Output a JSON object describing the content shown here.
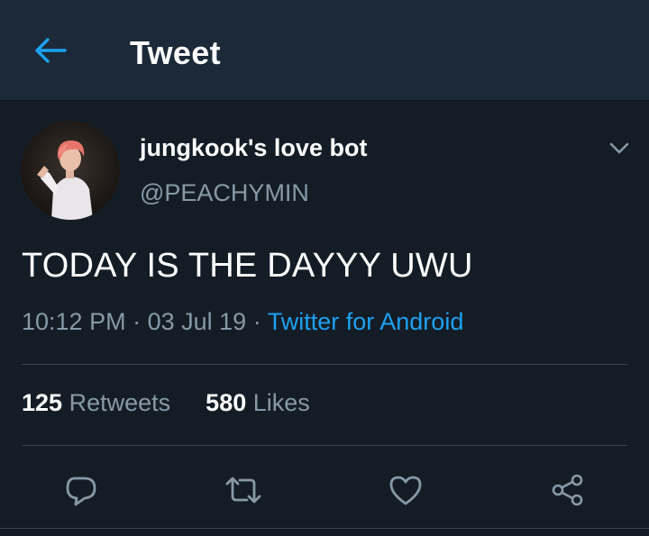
{
  "header": {
    "title": "Tweet",
    "back_icon": "arrow-left-icon"
  },
  "tweet": {
    "display_name": "jungkook's love bot",
    "handle": "@PEACHYMIN",
    "text": "TODAY IS THE DAYYY UWU",
    "time": "10:12 PM",
    "separator": "·",
    "date": "03 Jul 19",
    "source": "Twitter for Android"
  },
  "stats": {
    "retweets_count": "125",
    "retweets_label": "Retweets",
    "likes_count": "580",
    "likes_label": "Likes"
  },
  "actions": {
    "reply_icon": "reply-icon",
    "retweet_icon": "retweet-icon",
    "like_icon": "heart-icon",
    "share_icon": "share-icon"
  },
  "colors": {
    "background": "#141d26",
    "header_background": "#1c2938",
    "accent": "#1da1f2",
    "secondary_text": "#8899a6",
    "divider": "#38444d"
  }
}
